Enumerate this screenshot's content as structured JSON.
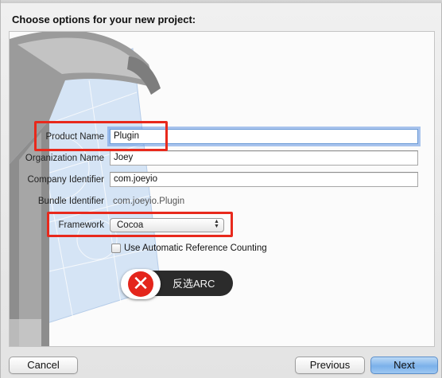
{
  "header": {
    "title": "Choose options for your new project:"
  },
  "form": {
    "product_name": {
      "label": "Product Name",
      "value": "Plugin"
    },
    "organization_name": {
      "label": "Organization Name",
      "value": "Joey"
    },
    "company_identifier": {
      "label": "Company Identifier",
      "value": "com.joeyio"
    },
    "bundle_identifier": {
      "label": "Bundle Identifier",
      "value": "com.joeyio.Plugin"
    },
    "framework": {
      "label": "Framework",
      "selected": "Cocoa"
    },
    "arc_checkbox": {
      "label": "Use Automatic Reference Counting",
      "checked": false
    }
  },
  "annotation": {
    "callout_text": "反选ARC",
    "icon": "x-icon",
    "color": "#e8291c"
  },
  "footer": {
    "cancel_label": "Cancel",
    "previous_label": "Previous",
    "next_label": "Next"
  },
  "colors": {
    "focus_ring": "#6a9ad6",
    "default_button": "#7bb1ea",
    "annotation_red": "#e8291c"
  }
}
